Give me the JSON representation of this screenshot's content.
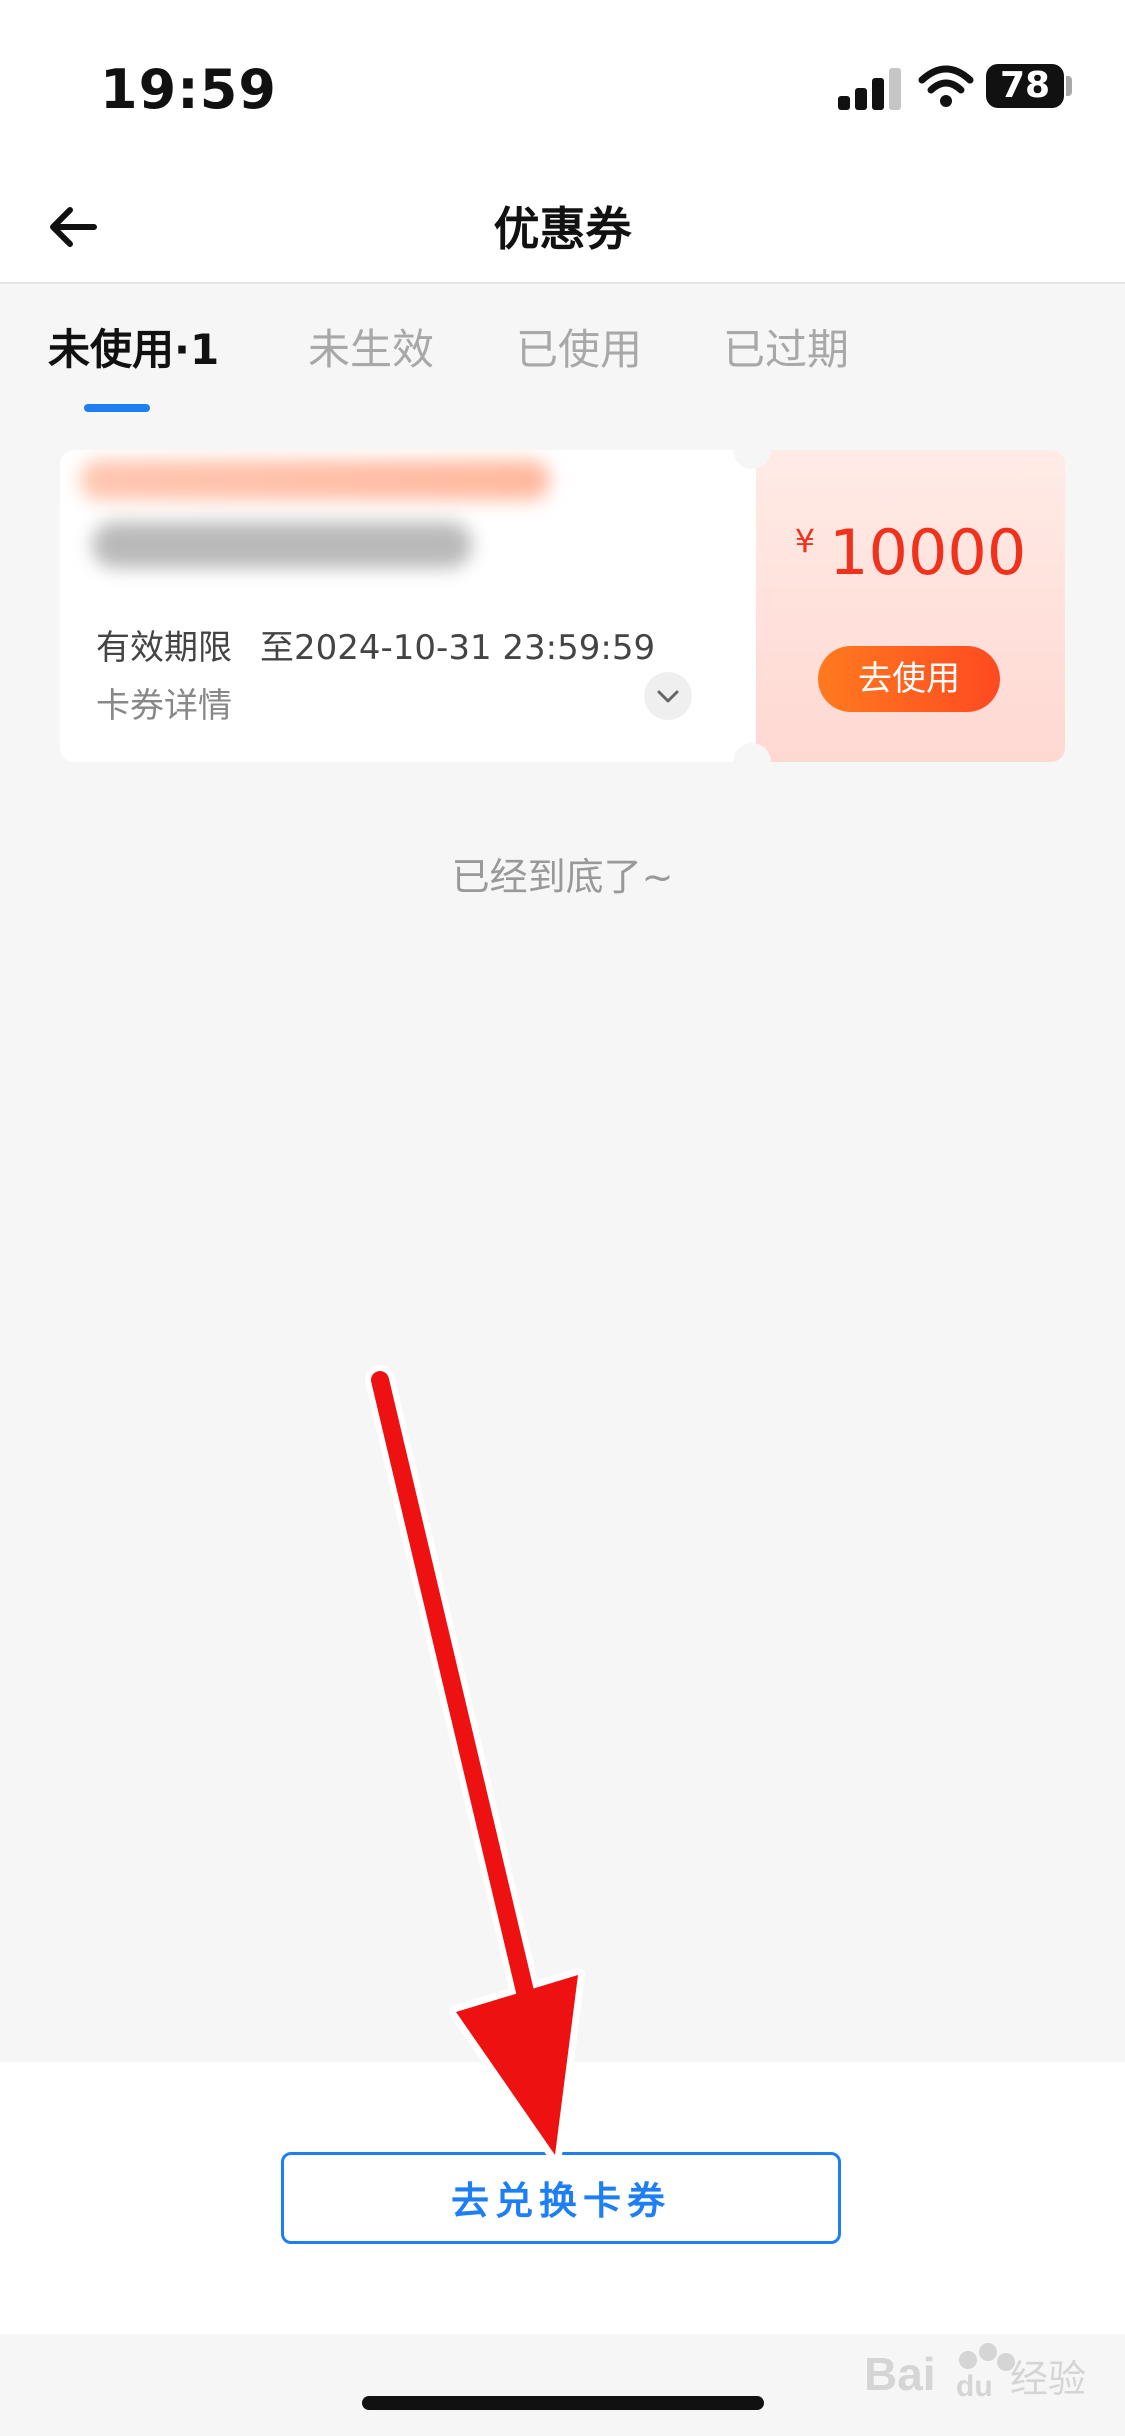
{
  "status_bar": {
    "time": "19:59",
    "battery": "78"
  },
  "nav": {
    "title": "优惠券"
  },
  "tabs": [
    {
      "label": "未使用·1",
      "active": true
    },
    {
      "label": "未生效",
      "active": false
    },
    {
      "label": "已使用",
      "active": false
    },
    {
      "label": "已过期",
      "active": false
    }
  ],
  "coupon": {
    "validity_label": "有效期限",
    "validity_value": "至2024-10-31 23:59:59",
    "details_label": "卡券详情",
    "currency": "¥",
    "amount": "10000",
    "use_label": "去使用"
  },
  "list_end_text": "已经到底了~",
  "bottom": {
    "redeem_label": "去兑换卡券"
  },
  "watermark": {
    "brand": "Baidu 经验"
  },
  "colors": {
    "accent": "#1e7ff5",
    "price": "#f0311c",
    "use_button": "#ff5a1f",
    "annotation": "#ee1111"
  },
  "icons": [
    "back-arrow-icon",
    "signal-icon",
    "wifi-icon",
    "battery-icon",
    "chevron-down-icon",
    "annotation-arrow-icon"
  ]
}
